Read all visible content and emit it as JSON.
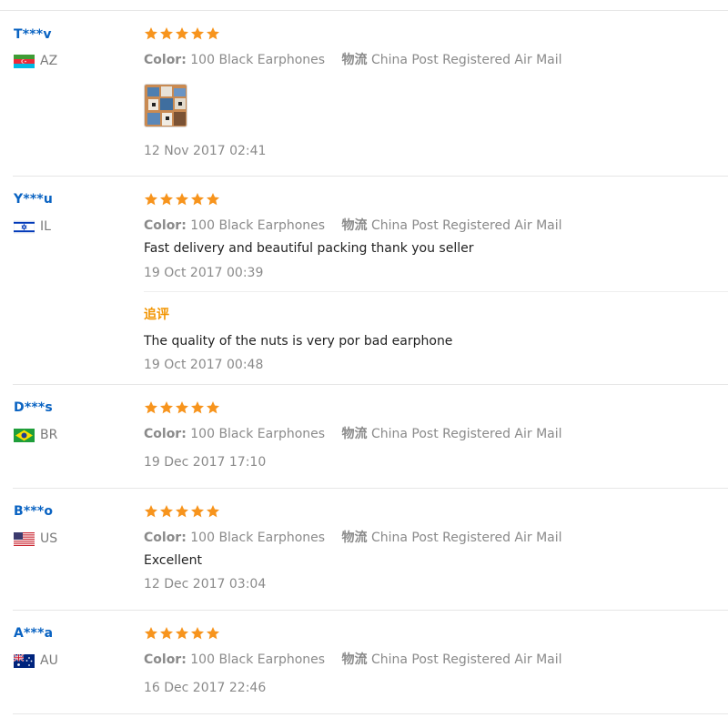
{
  "reviews": [
    {
      "buyer": "T***v",
      "country_code": "AZ",
      "rating": 5,
      "color_label": "Color:",
      "color_value": "100 Black Earphones",
      "shipping_label": "物流",
      "shipping_value": "China Post Registered Air Mail",
      "has_photo": true,
      "photo_icon": "product-photo-thumbnail",
      "text": "",
      "date": "12 Nov 2017 02:41"
    },
    {
      "buyer": "Y***u",
      "country_code": "IL",
      "rating": 5,
      "color_label": "Color:",
      "color_value": "100 Black Earphones",
      "shipping_label": "物流",
      "shipping_value": "China Post Registered Air Mail",
      "text": "Fast delivery and beautiful packing thank you seller",
      "date": "19 Oct 2017 00:39",
      "followup": {
        "label": "追评",
        "text": "The quality of the nuts is very por bad earphone",
        "date": "19 Oct 2017 00:48"
      }
    },
    {
      "buyer": "D***s",
      "country_code": "BR",
      "rating": 5,
      "color_label": "Color:",
      "color_value": "100 Black Earphones",
      "shipping_label": "物流",
      "shipping_value": "China Post Registered Air Mail",
      "text": "",
      "date": "19 Dec 2017 17:10"
    },
    {
      "buyer": "B***o",
      "country_code": "US",
      "rating": 5,
      "color_label": "Color:",
      "color_value": "100 Black Earphones",
      "shipping_label": "物流",
      "shipping_value": "China Post Registered Air Mail",
      "text": "Excellent",
      "date": "12 Dec 2017 03:04"
    },
    {
      "buyer": "A***a",
      "country_code": "AU",
      "rating": 5,
      "color_label": "Color:",
      "color_value": "100 Black Earphones",
      "shipping_label": "物流",
      "shipping_value": "China Post Registered Air Mail",
      "text": "",
      "date": "16 Dec 2017 22:46"
    }
  ],
  "colors": {
    "buyer_name": "#0a63c2",
    "star": "#f7941d",
    "followup_label": "#f29400",
    "meta_text": "#8a8a8a",
    "divider": "#e6e6e6"
  }
}
